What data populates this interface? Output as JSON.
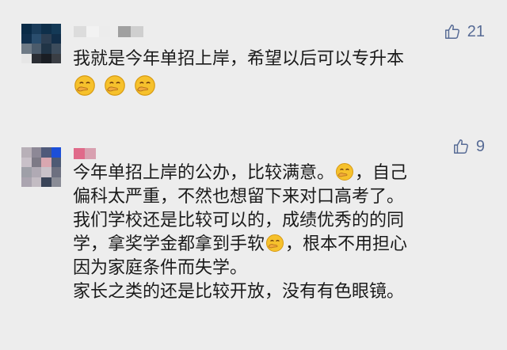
{
  "comments": [
    {
      "likes": "21",
      "text_lines": [
        "我就是今年单招上岸，希望以后可以专升本"
      ],
      "emoji_count": 3
    },
    {
      "likes": "9",
      "lines": {
        "l1a": "今年单招上岸的公办，比较满意。",
        "l1b": "，自己",
        "l2": "偏科太严重，不然也想留下来对口高考了。",
        "l3": "我们学校还是比较可以的，成绩优秀的的同",
        "l4a": "学，拿奖学金都拿到手软",
        "l4b": "，根本不用担心",
        "l5": "因为家庭条件而失学。",
        "l6": "家长之类的还是比较开放，没有有色眼镜。"
      }
    }
  ],
  "colors": {
    "background": "#ededed",
    "text": "#1a1a1a",
    "like_accent": "#576b95",
    "emoji_face": "#f6c12c"
  },
  "icons": {
    "like": "thumbs-up-icon",
    "emoji": "hand-over-mouth-smirk-emoji"
  }
}
